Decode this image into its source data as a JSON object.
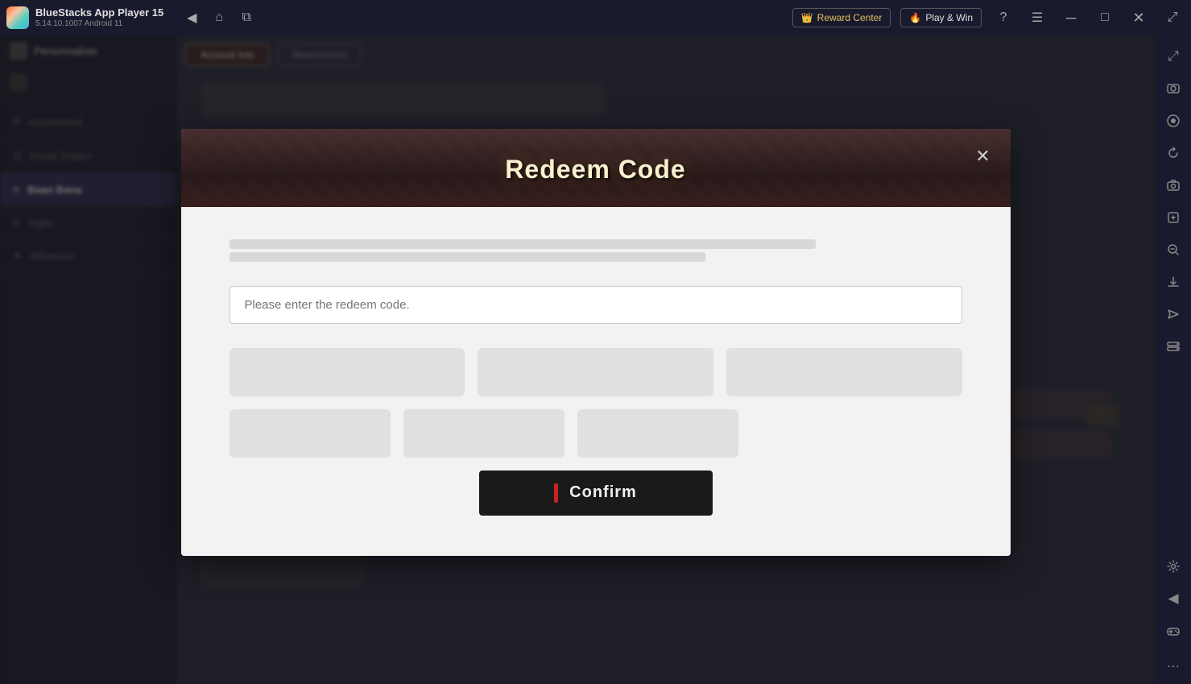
{
  "titlebar": {
    "app_name": "BlueStacks App Player 15",
    "app_version": "5.14.10.1007  Android 11",
    "reward_center_label": "Reward Center",
    "play_win_label": "Play & Win",
    "nav_back_icon": "◀",
    "nav_home_icon": "⌂",
    "nav_tabs_icon": "⧉",
    "help_icon": "?",
    "menu_icon": "☰",
    "minimize_icon": "─",
    "maximize_icon": "□",
    "close_icon": "✕",
    "expand_icon": "⤢"
  },
  "right_sidebar": {
    "icons": [
      {
        "name": "expand-sidebar-icon",
        "glyph": "⤢"
      },
      {
        "name": "screenshot-icon",
        "glyph": "📷"
      },
      {
        "name": "record-icon",
        "glyph": "⊙"
      },
      {
        "name": "refresh-icon",
        "glyph": "↻"
      },
      {
        "name": "camera-icon",
        "glyph": "📸"
      },
      {
        "name": "zoom-in-icon",
        "glyph": "⊕"
      },
      {
        "name": "zoom-out-icon",
        "glyph": "⊖"
      },
      {
        "name": "download-icon",
        "glyph": "⬇"
      },
      {
        "name": "airplane-icon",
        "glyph": "✈"
      },
      {
        "name": "storage-icon",
        "glyph": "💾"
      },
      {
        "name": "settings-icon",
        "glyph": "⚙"
      },
      {
        "name": "arrow-left-icon",
        "glyph": "◀"
      },
      {
        "name": "gamepad-icon",
        "glyph": "🎮"
      },
      {
        "name": "more-icon",
        "glyph": "…"
      }
    ]
  },
  "modal": {
    "title": "Redeem Code",
    "close_icon": "✕",
    "input_placeholder": "Please enter the redeem code.",
    "confirm_label": "Confirm"
  },
  "background": {
    "left_items": [
      {
        "label": "Personnaliste",
        "icon": "◀"
      },
      {
        "label": "☁"
      },
      {
        "label": "≡  aaaannnniii"
      },
      {
        "label": "⊙  Hudai Daptur"
      },
      {
        "label": "≡  Ingite"
      },
      {
        "label": "✦  Allrannini"
      }
    ],
    "active_item": "Baan Bana",
    "top_tabs": [
      "Account Into",
      "Mannnnnnm"
    ]
  }
}
